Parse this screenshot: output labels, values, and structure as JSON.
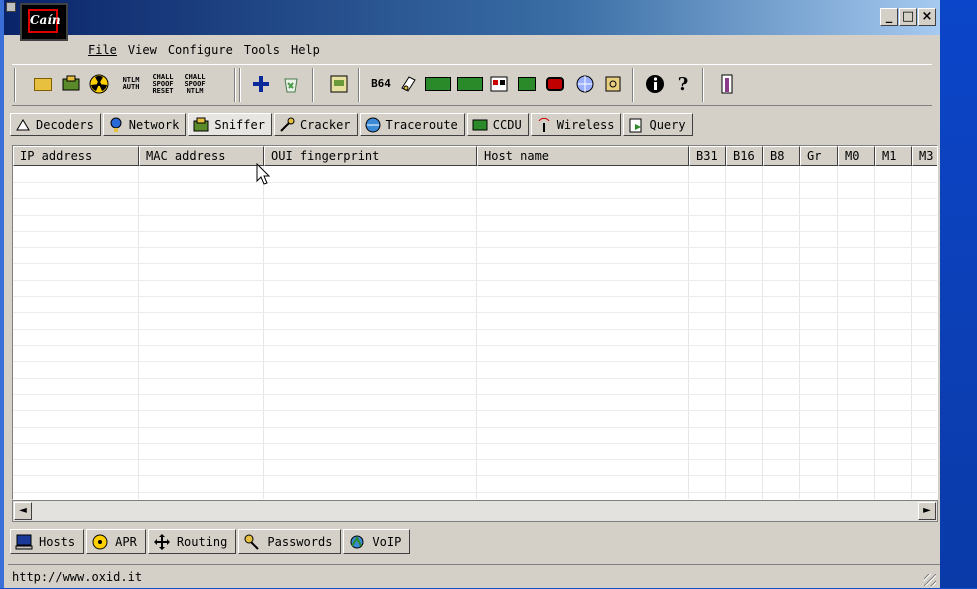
{
  "app": {
    "logo_text": "Caín",
    "url": "http://www.oxid.it"
  },
  "title_buttons": {
    "minimize": "_",
    "maximize": "□",
    "close": "×"
  },
  "menu": [
    {
      "label": "File"
    },
    {
      "label": "View"
    },
    {
      "label": "Configure"
    },
    {
      "label": "Tools"
    },
    {
      "label": "Help"
    }
  ],
  "toolbar": {
    "ntlm_auth": "NTLM\nAUTH",
    "chall_spoof_reset": "CHALL\nSPOOF\nRESET",
    "chall_spoof_ntlm": "CHALL\nSPOOF\nNTLM",
    "b64": "B64",
    "help_glyph": "?"
  },
  "top_tabs": [
    {
      "label": "Decoders",
      "icon": "decoders-icon"
    },
    {
      "label": "Network",
      "icon": "network-icon"
    },
    {
      "label": "Sniffer",
      "icon": "sniffer-icon"
    },
    {
      "label": "Cracker",
      "icon": "cracker-icon"
    },
    {
      "label": "Traceroute",
      "icon": "traceroute-icon"
    },
    {
      "label": "CCDU",
      "icon": "ccdu-icon"
    },
    {
      "label": "Wireless",
      "icon": "wireless-icon"
    },
    {
      "label": "Query",
      "icon": "query-icon"
    }
  ],
  "table": {
    "columns": [
      "IP address",
      "MAC address",
      "OUI fingerprint",
      "Host name",
      "B31",
      "B16",
      "B8",
      "Gr",
      "M0",
      "M1",
      "M3"
    ],
    "rows": []
  },
  "bottom_tabs": [
    {
      "label": "Hosts",
      "icon": "hosts-icon"
    },
    {
      "label": "APR",
      "icon": "apr-icon"
    },
    {
      "label": "Routing",
      "icon": "routing-icon"
    },
    {
      "label": "Passwords",
      "icon": "passwords-icon"
    },
    {
      "label": "VoIP",
      "icon": "voip-icon"
    }
  ],
  "scroll": {
    "left": "◄",
    "right": "►"
  }
}
